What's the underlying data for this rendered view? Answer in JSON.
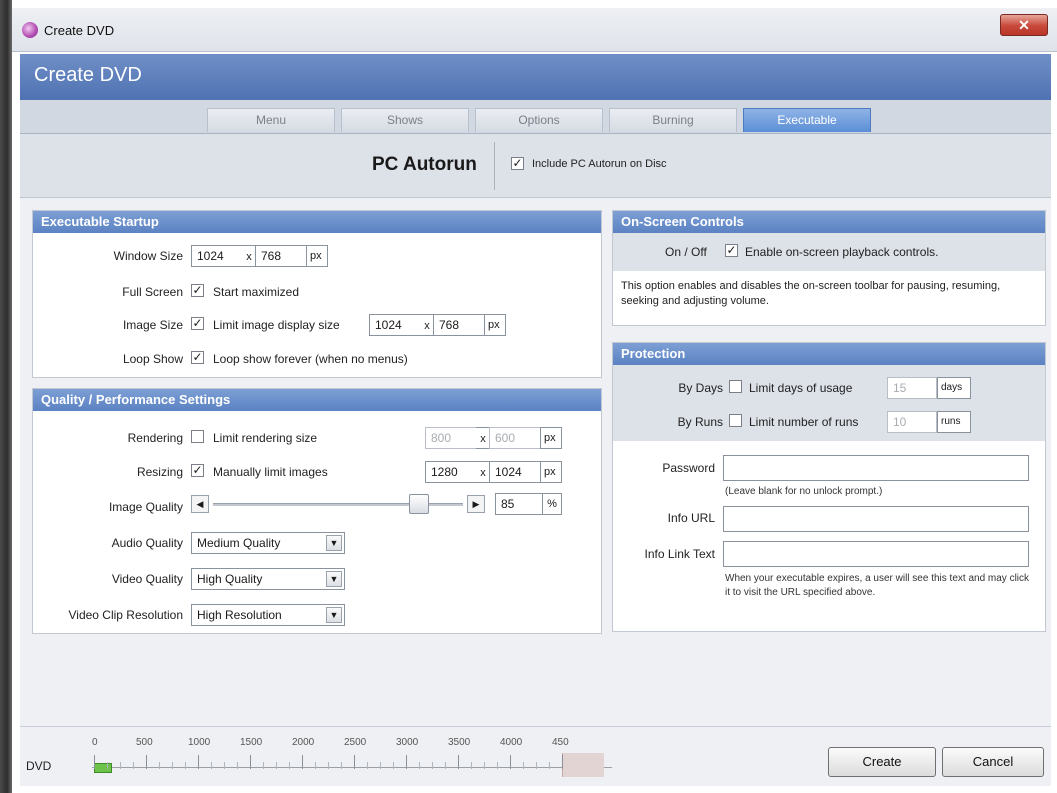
{
  "window": {
    "title": "Create DVD"
  },
  "banner": {
    "title": "Create DVD"
  },
  "tabs": [
    {
      "label": "Menu"
    },
    {
      "label": "Shows"
    },
    {
      "label": "Options"
    },
    {
      "label": "Burning"
    },
    {
      "label": "Executable"
    }
  ],
  "autorun": {
    "title": "PC Autorun",
    "include_label": "Include PC Autorun on Disc"
  },
  "startup": {
    "header": "Executable Startup",
    "window_size": {
      "label": "Window Size",
      "w": "1024",
      "h": "768",
      "unit": "px"
    },
    "full_screen": {
      "label": "Full Screen",
      "option": "Start maximized"
    },
    "image_size": {
      "label": "Image Size",
      "option": "Limit image display size",
      "w": "1024",
      "h": "768",
      "unit": "px"
    },
    "loop_show": {
      "label": "Loop Show",
      "option": "Loop show forever (when no menus)"
    },
    "x": "x"
  },
  "quality": {
    "header": "Quality / Performance Settings",
    "rendering": {
      "label": "Rendering",
      "option": "Limit rendering size",
      "w": "800",
      "h": "600",
      "unit": "px"
    },
    "resizing": {
      "label": "Resizing",
      "option": "Manually limit images",
      "w": "1280",
      "h": "1024",
      "unit": "px"
    },
    "image_quality": {
      "label": "Image Quality",
      "value": "85",
      "unit": "%",
      "level": 0.85
    },
    "audio_quality": {
      "label": "Audio Quality",
      "value": "Medium Quality"
    },
    "video_quality": {
      "label": "Video Quality",
      "value": "High Quality"
    },
    "video_clip": {
      "label": "Video Clip Resolution",
      "value": "High Resolution"
    }
  },
  "osc": {
    "header": "On-Screen Controls",
    "toggle_label": "On / Off",
    "option": "Enable on-screen playback controls.",
    "description": "This option enables and disables the on-screen toolbar for pausing, resuming, seeking and adjusting volume."
  },
  "protection": {
    "header": "Protection",
    "by_days": {
      "label": "By Days",
      "option": "Limit days of usage",
      "value": "15",
      "unit": "days"
    },
    "by_runs": {
      "label": "By Runs",
      "option": "Limit number of runs",
      "value": "10",
      "unit": "runs"
    },
    "password": {
      "label": "Password",
      "hint": "(Leave blank for no unlock prompt.)"
    },
    "info_url": {
      "label": "Info URL"
    },
    "info_link": {
      "label": "Info Link Text",
      "hint": "When your executable expires, a user will see this text and may click it to visit the URL specified above."
    }
  },
  "footer": {
    "disc_label": "DVD",
    "ticks": [
      "0",
      "500",
      "1000",
      "1500",
      "2000",
      "2500",
      "3000",
      "3500",
      "4000",
      "450"
    ],
    "create": "Create",
    "cancel": "Cancel"
  }
}
